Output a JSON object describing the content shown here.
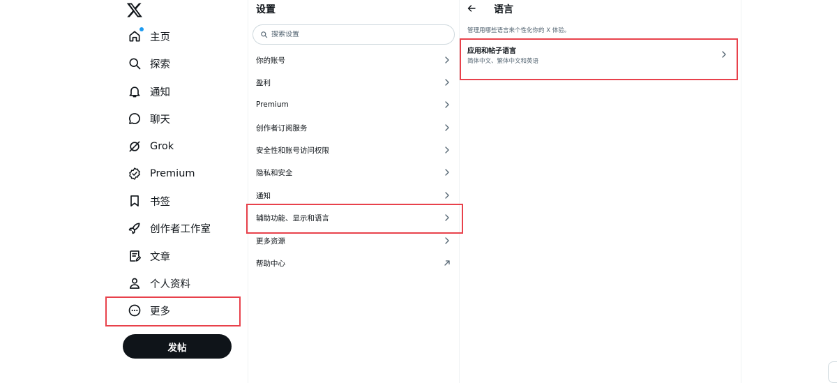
{
  "nav": {
    "logo": "x-logo-icon",
    "items": [
      {
        "id": "home",
        "label": "主页",
        "icon": "home-icon",
        "has_dot": true
      },
      {
        "id": "explore",
        "label": "探索",
        "icon": "search-icon"
      },
      {
        "id": "notifications",
        "label": "通知",
        "icon": "bell-icon"
      },
      {
        "id": "chat",
        "label": "聊天",
        "icon": "chat-bubble-icon"
      },
      {
        "id": "grok",
        "label": "Grok",
        "icon": "grok-icon"
      },
      {
        "id": "premium",
        "label": "Premium",
        "icon": "verified-badge-icon"
      },
      {
        "id": "bookmarks",
        "label": "书签",
        "icon": "bookmark-icon"
      },
      {
        "id": "creator-studio",
        "label": "创作者工作室",
        "icon": "rocket-icon"
      },
      {
        "id": "articles",
        "label": "文章",
        "icon": "article-icon"
      },
      {
        "id": "profile",
        "label": "个人资料",
        "icon": "person-icon"
      },
      {
        "id": "more",
        "label": "更多",
        "icon": "more-circle-icon"
      }
    ],
    "post_button": "发帖",
    "accent_color": "#1d9bf0"
  },
  "settings": {
    "title": "设置",
    "search": {
      "placeholder": "搜索设置",
      "value": ""
    },
    "items": [
      {
        "label": "你的账号",
        "icon": "chevron-right-icon"
      },
      {
        "label": "盈利",
        "icon": "chevron-right-icon"
      },
      {
        "label": "Premium",
        "icon": "chevron-right-icon"
      },
      {
        "label": "创作者订阅服务",
        "icon": "chevron-right-icon"
      },
      {
        "label": "安全性和账号访问权限",
        "icon": "chevron-right-icon"
      },
      {
        "label": "隐私和安全",
        "icon": "chevron-right-icon"
      },
      {
        "label": "通知",
        "icon": "chevron-right-icon"
      },
      {
        "label": "辅助功能、显示和语言",
        "icon": "chevron-right-icon"
      },
      {
        "label": "更多资源",
        "icon": "chevron-right-icon"
      },
      {
        "label": "帮助中心",
        "icon": "external-link-arrow-icon"
      }
    ]
  },
  "language": {
    "back_icon": "arrow-left-icon",
    "title": "语言",
    "description": "管理用哪些语言来个性化你的 X 体验。",
    "row": {
      "title": "应用和帖子语言",
      "subtitle": "简体中文、繁体中文和英语",
      "icon": "chevron-right-icon"
    }
  },
  "colors": {
    "highlight": "#e8414b",
    "text_primary": "#0f1419",
    "text_secondary": "#536471"
  }
}
